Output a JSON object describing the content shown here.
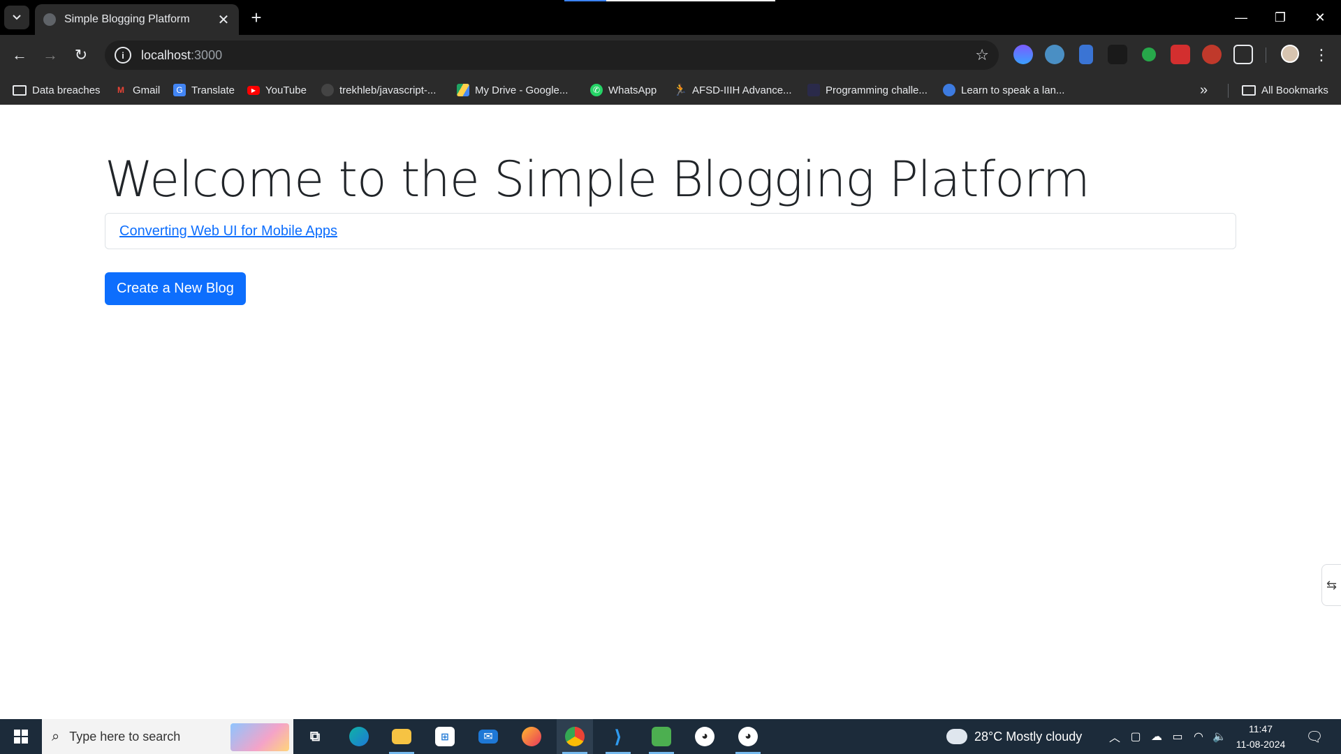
{
  "browser": {
    "tab_title": "Simple Blogging Platform",
    "tab_close": "✕",
    "new_tab": "+",
    "url_host": "localhost",
    "url_port": ":3000",
    "window_minimize": "—",
    "window_restore": "❐",
    "window_close": "✕",
    "bookmarks": [
      {
        "label": "Data breaches",
        "icon": "folder-icon"
      },
      {
        "label": "Gmail",
        "icon": "gmail-icon",
        "color": "#ea4335"
      },
      {
        "label": "Translate",
        "icon": "translate-icon",
        "color": "#4285f4"
      },
      {
        "label": "YouTube",
        "icon": "youtube-icon",
        "color": "#ff0000"
      },
      {
        "label": "trekhleb/javascript-...",
        "icon": "github-icon",
        "color": "#444444"
      },
      {
        "label": "My Drive - Google...",
        "icon": "drive-icon",
        "color": "#1fa463"
      },
      {
        "label": "WhatsApp",
        "icon": "whatsapp-icon",
        "color": "#25d366"
      },
      {
        "label": "AFSD-IIIH Advance...",
        "icon": "runner-icon",
        "color": "#7cb342"
      },
      {
        "label": "Programming challe...",
        "icon": "code-icon",
        "color": "#2a2a4a"
      },
      {
        "label": "Learn to speak a lan...",
        "icon": "person-icon",
        "color": "#3d7be0"
      }
    ],
    "bookmarks_overflow": "»",
    "all_bookmarks": "All Bookmarks"
  },
  "page": {
    "heading": "Welcome to the Simple Blogging Platform",
    "blogs": [
      {
        "title": "Converting Web UI for Mobile Apps"
      }
    ],
    "create_button": "Create a New Blog"
  },
  "taskbar": {
    "search_placeholder": "Type here to search",
    "weather": "28°C  Mostly cloudy",
    "time": "11:47",
    "date": "11-08-2024"
  },
  "colors": {
    "primary": "#0d6efd",
    "chrome_dark": "#2b2b2b",
    "taskbar": "#1c2b3a"
  }
}
